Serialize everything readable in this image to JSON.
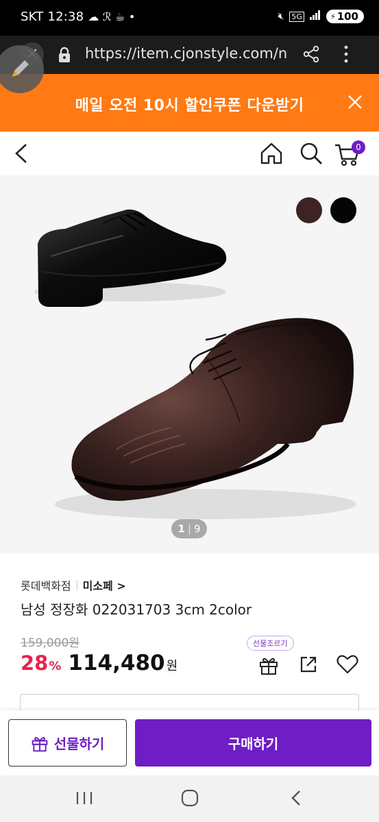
{
  "status_bar": {
    "carrier": "SKT",
    "time": "12:38",
    "network": "5G",
    "battery": "100"
  },
  "browser": {
    "url": "https://item.cjonstyle.com/nf"
  },
  "promo": {
    "text": "매일 오전 10시 할인쿠폰 다운받기"
  },
  "header": {
    "cart_count": "0"
  },
  "gallery": {
    "current_page": "1",
    "total_pages": "9",
    "swatches": [
      {
        "color": "#3d2322"
      },
      {
        "color": "#050505"
      }
    ]
  },
  "product": {
    "brand": "롯데백화점",
    "sub_brand": "미소페 >",
    "title": "남성 정장화 022031703 3cm 2color",
    "original_price": "159,000원",
    "discount": "28",
    "discount_unit": "%",
    "price": "114,480",
    "currency": "원",
    "gift_tooltip": "선물조르기"
  },
  "actions": {
    "gift_label": "선물하기",
    "buy_label": "구매하기"
  },
  "colors": {
    "accent": "#6f1dc4",
    "promo": "#ff7a14",
    "discount": "#e8244e"
  }
}
